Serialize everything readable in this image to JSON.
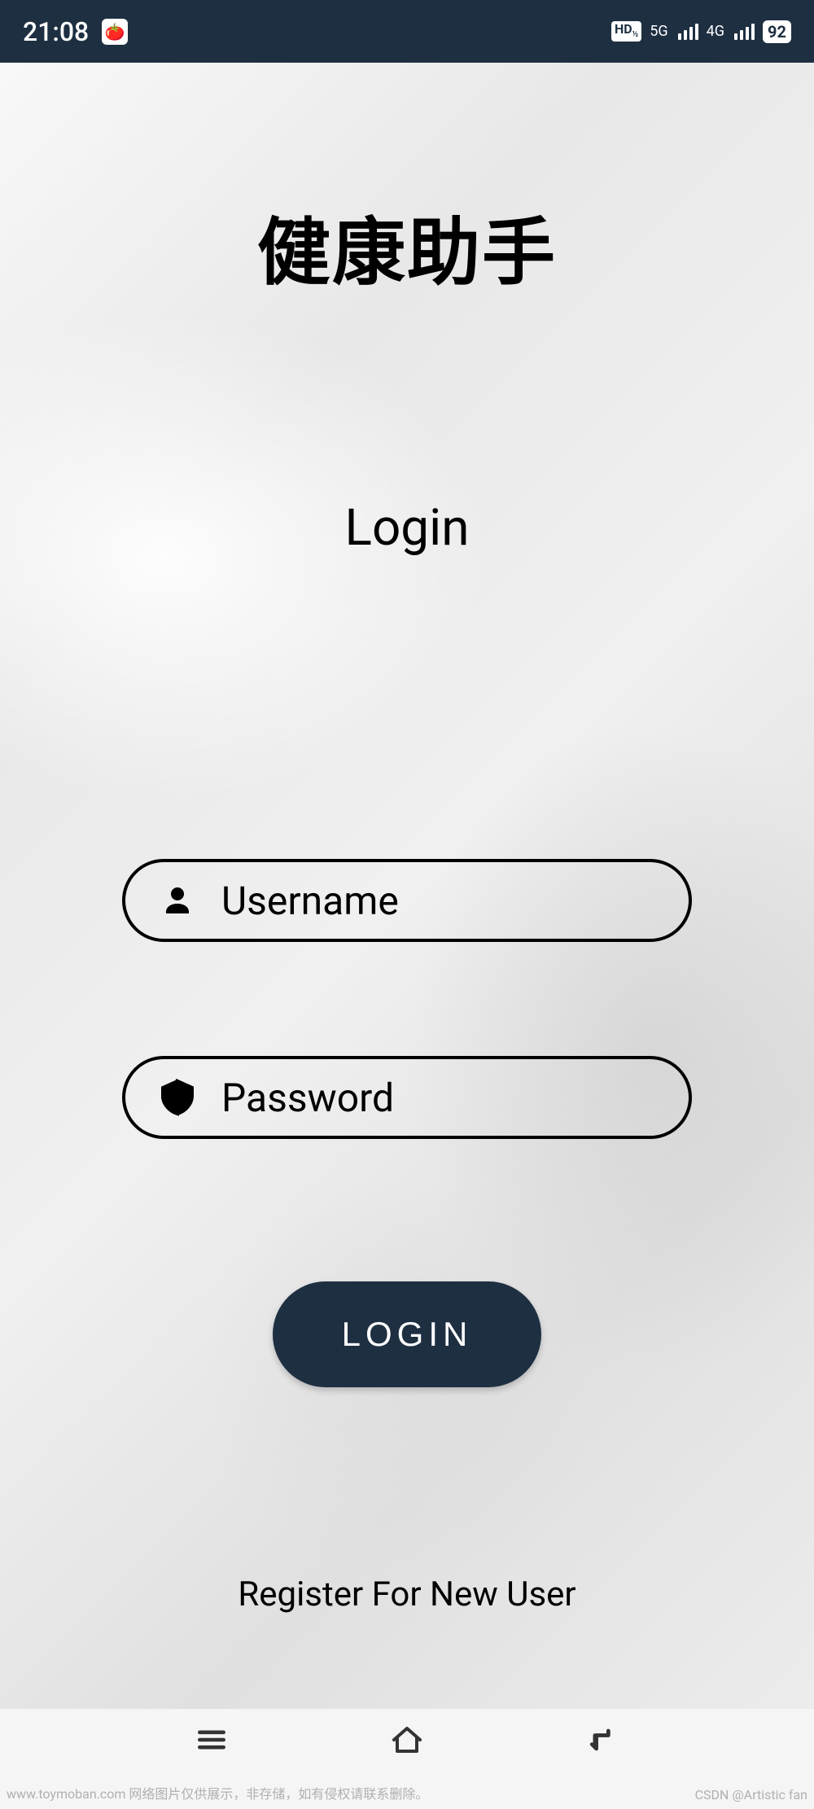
{
  "status_bar": {
    "time": "21:08",
    "hd_label": "HD",
    "hd_sub": "1\n2",
    "signal_5g": "5G",
    "signal_4g": "4G",
    "battery": "92"
  },
  "main": {
    "app_title": "健康助手",
    "login_heading": "Login",
    "username": {
      "placeholder": "Username",
      "icon": "person-icon"
    },
    "password": {
      "placeholder": "Password",
      "icon": "shield-icon"
    },
    "login_button": "LOGIN",
    "register_link": "Register For New User"
  },
  "footer": {
    "left": "www.toymoban.com 网络图片仅供展示，非存储，如有侵权请联系删除。",
    "right": "CSDN @Artistic fan"
  },
  "colors": {
    "primary": "#1e2f42",
    "text": "#000000"
  }
}
